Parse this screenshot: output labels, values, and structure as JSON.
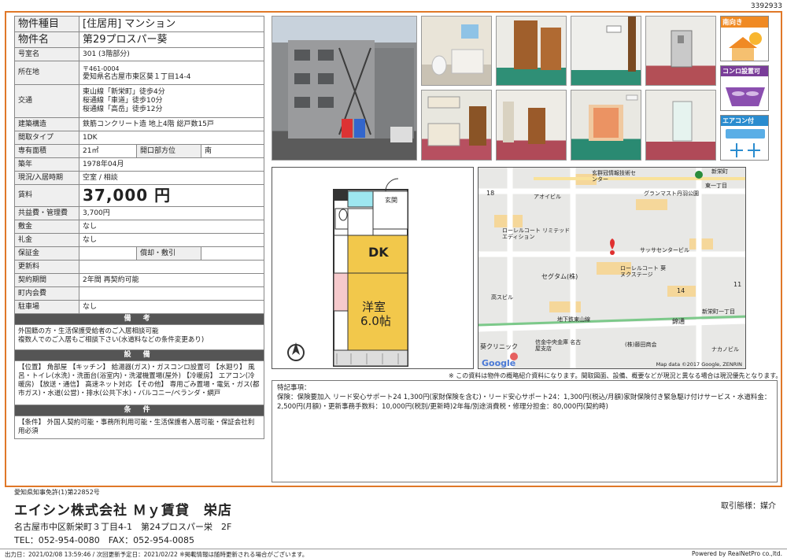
{
  "doc_id": "3392933",
  "table": {
    "type_label": "物件種目",
    "type_value": "[住居用] マンション",
    "name_label": "物件名",
    "name_value": "第29プロスパー葵",
    "room_label": "号室名",
    "room_value": "301 (3階部分)",
    "addr_label": "所在地",
    "addr_zip": "〒461-0004",
    "addr_value": "愛知県名古屋市東区葵１丁目14-4",
    "transit_label": "交通",
    "transit_1": "東山線「新栄町」徒歩4分",
    "transit_2": "桜通線「車道」徒歩10分",
    "transit_3": "桜通線「高岳」徒歩12分",
    "struct_label": "建築構造",
    "struct_value": "鉄筋コンクリート造 地上4階 総戸数15戸",
    "layout_label": "間取タイプ",
    "layout_value": "1DK",
    "area_label": "専有面積",
    "area_value": "21㎡",
    "dir_label": "開口部方位",
    "dir_value": "南",
    "built_label": "築年",
    "built_value": "1978年04月",
    "status_label": "現況/入居時期",
    "status_value": "空室 / 相談",
    "rent_label": "賃料",
    "rent_value": "37,000 円",
    "fee_label": "共益費・管理費",
    "fee_value": "3,700円",
    "deposit_label": "敷金",
    "deposit_value": "なし",
    "key_label": "礼金",
    "key_value": "なし",
    "guarantee_label": "保証金",
    "guarantee_value": "",
    "shokyaku_label": "償却・敷引",
    "shokyaku_value": "",
    "renew_label": "更新料",
    "renew_value": "",
    "contract_label": "契約期間",
    "contract_value": "2年間 再契約可能",
    "town_label": "町内会費",
    "town_value": "",
    "parking_label": "駐車場",
    "parking_value": "なし",
    "remarks_header": "備 考",
    "remarks_text": "外国籍の方・生活保護受給者のご入居相談可能\n複数人でのご入居もご相談下さい(水道料などの条件変更あり)",
    "equip_header": "設 備",
    "equip_text": "【位置】 角部屋 【キッチン】 給湯器(ガス)・ガスコンロ設置可 【水廻り】 風呂・トイレ(水洗)・洗面台(浴室内)・洗濯機置場(屋外) 【冷暖房】 エアコン(冷暖房) 【放送・通信】 高速ネット対応 【その他】 専用ごみ置場・電気・ガス(都市ガス)・水道(公営)・排水(公共下水)・バルコニー/ベランダ・網戸",
    "cond_header": "条 件",
    "cond_text": "【条件】 外国人契約可能・事務所利用可能・生活保護者入居可能・保証会社利用必須"
  },
  "badges": {
    "south": "南向き",
    "stove": "コンロ設置可",
    "aircon": "エアコン付"
  },
  "floorplan": {
    "entrance": "玄関",
    "dk": "DK",
    "room": "洋室",
    "room_size": "6.0帖"
  },
  "map": {
    "labels": [
      "玄群冠情報技術センター",
      "グランマスト丹羽公園",
      "アオイビル",
      "ローレルコート リミテッドエディション",
      "サッサセンタービル",
      "セグタム(株)",
      "ローレルコート 葵ヌクステージ",
      "高スビル",
      "地下鉄東山線",
      "錦通",
      "葵クリニック",
      "信金中央金庫 名古屋支店",
      "(株)藤田商会",
      "ナカノビル",
      "新栄町",
      "14",
      "11",
      "18",
      "東一丁目",
      "新栄町一丁目"
    ],
    "google": "Google",
    "credit": "Map data ©2017 Google, ZENRIN"
  },
  "note": "※ この資料は物件の概略紹介資料になります。間取図面、設備、概要などが現況と異なる場合は現況優先となります。",
  "special_title": "特記事項：",
  "special_text": "保険：保険要加入 リード安心サポート24 1,300円(家財保険を含む)・リード安心サポート24：1,300円(税込/月額)家財保険付き緊急駆け付けサービス・水道料金：2,500円(月額)・更新事務手数料：10,000円(税別/更新時)2年毎/別途消費税・修理分担金：80,000円(契約時)",
  "company": {
    "license": "愛知県知事免許(1)第22852号",
    "name": "エイシン株式会社 Ｍｙ賃貸　栄店",
    "address": "名古屋市中区新栄町３丁目4-1　第24プロスパー栄　2F",
    "tel": "TEL：052-954-0080　FAX：052-954-0085"
  },
  "torihiki": "取引態様：媒介",
  "footer_left": "出力日：2021/02/08 13:59:46 / 次回更新予定日：2021/02/22 ※掲載情報は随時更新される場合がございます。",
  "powered": "Powered by RealNetPro co.,ltd."
}
